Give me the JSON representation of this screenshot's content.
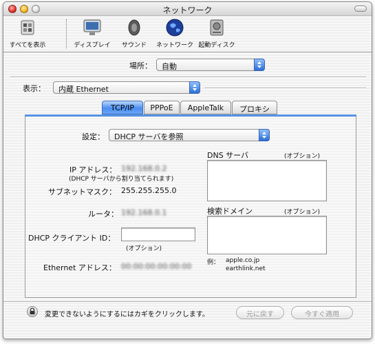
{
  "window": {
    "title": "ネットワーク"
  },
  "toolbar": {
    "items": [
      {
        "label": "すべてを表示",
        "icon": "show-all-icon"
      },
      {
        "label": "ディスプレイ",
        "icon": "display-icon"
      },
      {
        "label": "サウンド",
        "icon": "speaker-icon"
      },
      {
        "label": "ネットワーク",
        "icon": "globe-icon"
      },
      {
        "label": "起動ディスク",
        "icon": "disk-icon"
      }
    ]
  },
  "location": {
    "label": "場所：",
    "value": "自動"
  },
  "show": {
    "label": "表示：",
    "value": "内蔵 Ethernet"
  },
  "tabs": [
    "TCP/IP",
    "PPPoE",
    "AppleTalk",
    "プロキシ"
  ],
  "config": {
    "label": "設定：",
    "value": "DHCP サーバを参照"
  },
  "ip": {
    "label": "IP アドレス：",
    "value": "192.168.0.2",
    "note": "(DHCP サーバから割り当てられます)"
  },
  "subnet": {
    "label": "サブネットマスク：",
    "value": "255.255.255.0"
  },
  "router": {
    "label": "ルータ：",
    "value": "192.168.0.1"
  },
  "dhcp_client": {
    "label": "DHCP クライアント ID：",
    "value": "",
    "note": "(オプション)"
  },
  "ethernet": {
    "label": "Ethernet アドレス：",
    "value": "00:00:00:00:00:00"
  },
  "dns": {
    "label": "DNS サーバ",
    "note": "(オプション)",
    "value": ""
  },
  "search": {
    "label": "検索ドメイン",
    "note": "(オプション)",
    "value": ""
  },
  "example": {
    "label": "例：",
    "line1": "apple.co.jp",
    "line2": "earthlink.net"
  },
  "footer": {
    "lock_text": "変更できないようにするにはカギをクリックします。",
    "revert_label": "元に戻す",
    "apply_label": "今すぐ適用"
  }
}
